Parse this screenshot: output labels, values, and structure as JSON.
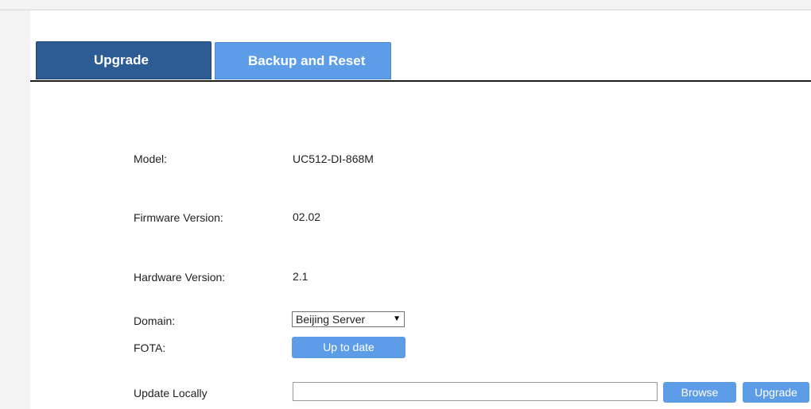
{
  "tabs": {
    "upgrade": "Upgrade",
    "backup": "Backup and Reset"
  },
  "fields": {
    "model_label": "Model:",
    "model_value": "UC512-DI-868M",
    "firmware_label": "Firmware Version:",
    "firmware_value": "02.02",
    "hardware_label": "Hardware Version:",
    "hardware_value": "2.1",
    "domain_label": "Domain:",
    "domain_value": "Beijing Server",
    "fota_label": "FOTA:",
    "fota_button": "Up to date",
    "local_label": "Update Locally",
    "local_value": "",
    "browse_button": "Browse",
    "upgrade_button": "Upgrade"
  },
  "icons": {
    "dropdown": "dropdown-arrow-icon"
  },
  "colors": {
    "active_tab": "#2d5b94",
    "inactive_tab": "#5d9de8",
    "button": "#5d9de8"
  }
}
